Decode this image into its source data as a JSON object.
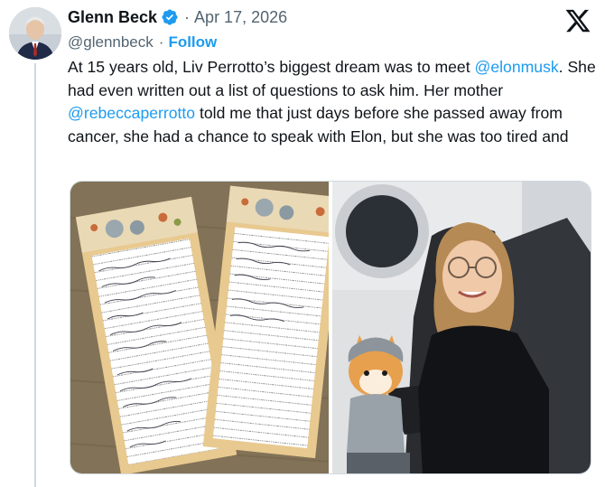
{
  "author": {
    "display_name": "Glenn Beck",
    "handle": "@glennbeck",
    "verified_icon": "verified-badge-icon"
  },
  "post": {
    "separator": "·",
    "date": "Apr 17, 2026",
    "follow_label": "Follow",
    "text_parts": {
      "p1": "At 15 years old, Liv Perrotto’s biggest dream was to meet ",
      "m1": "@elonmusk",
      "p2": ". She had even written out a list of questions to ask him. Her mother ",
      "m2": "@rebeccaperrotto",
      "p3": " told me that just days before she passed away from cancer, she had a chance to speak with Elon, but she was too tired and"
    }
  },
  "colors": {
    "link": "#1d9bf0",
    "muted": "#536471",
    "text": "#0f1419",
    "verified": "#1d9bf0"
  },
  "media": {
    "count": 2,
    "icons": [
      "x-logo-icon",
      "verified-badge-icon"
    ]
  }
}
